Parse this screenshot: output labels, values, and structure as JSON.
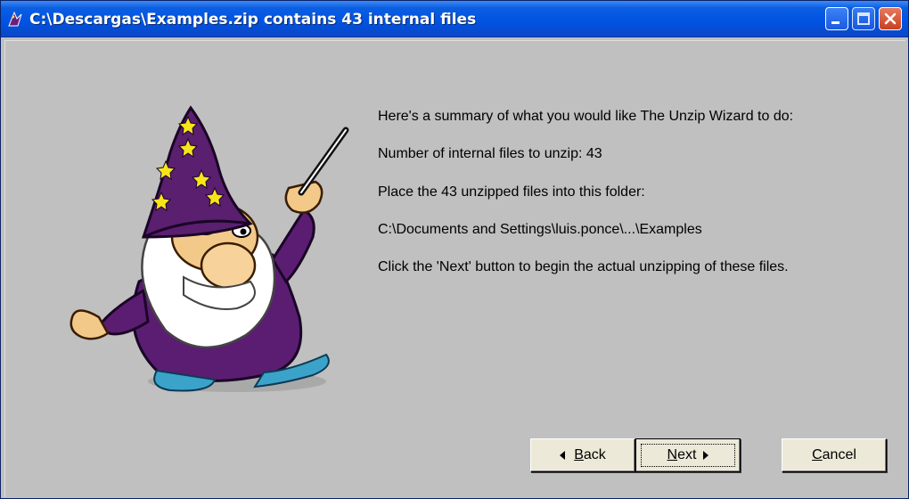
{
  "window": {
    "title": "C:\\Descargas\\Examples.zip contains 43 internal files"
  },
  "summary": {
    "line1": "Here's a summary of what you would like The Unzip Wizard to do:",
    "line2": "Number of internal files to unzip: 43",
    "line3": "Place the 43 unzipped files into this folder:",
    "line4": "C:\\Documents and Settings\\luis.ponce\\...\\Examples",
    "line5": "Click the 'Next' button to begin the actual unzipping of these files."
  },
  "buttons": {
    "back": {
      "mnemonic": "B",
      "rest": "ack"
    },
    "next": {
      "mnemonic": "N",
      "rest": "ext"
    },
    "cancel": {
      "mnemonic": "C",
      "rest": "ancel"
    }
  },
  "colors": {
    "title_bar": "#0054e3",
    "window_bg": "#c0c0c0",
    "wizard_hat": "#5a1f6e",
    "wizard_stars": "#f7e51b",
    "wizard_robe": "#5b1d72"
  },
  "icons": [
    "wizard-app-icon",
    "minimize-icon",
    "maximize-icon",
    "close-icon",
    "wizard-illustration",
    "arrow-left-icon",
    "arrow-right-icon"
  ]
}
